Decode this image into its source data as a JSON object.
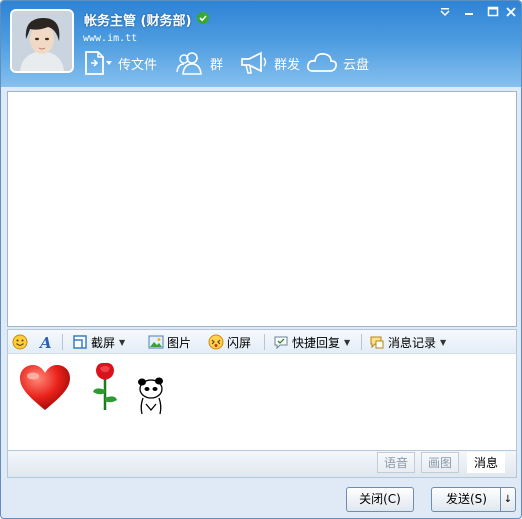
{
  "header": {
    "contact_name": "帐务主管 (财务部)",
    "signature": "www.im.tt",
    "avatar_icon": "avatar-portrait",
    "status_icon": "online-check-icon"
  },
  "window_controls": [
    "settings-icon",
    "minimize-icon",
    "maximize-icon",
    "close-icon"
  ],
  "top_toolbar": {
    "send_file": "传文件",
    "group": "群",
    "broadcast": "群发",
    "cloud": "云盘"
  },
  "input_toolbar": {
    "screenshot": "截屏",
    "picture": "图片",
    "flash_screen": "闪屏",
    "quick_reply": "快捷回复",
    "message_history": "消息记录"
  },
  "input_content": [
    "heart-emoji",
    "rose-emoji",
    "panda-emoji"
  ],
  "mode_tabs": {
    "voice": "语音",
    "draw": "画图",
    "message": "消息",
    "selected": "消息"
  },
  "buttons": {
    "close": "关闭(C)",
    "send": "发送(S)"
  },
  "colors": {
    "header_top": "#2f83d4",
    "header_bottom": "#86c0ee",
    "window_bg": "#dfeaf6"
  }
}
